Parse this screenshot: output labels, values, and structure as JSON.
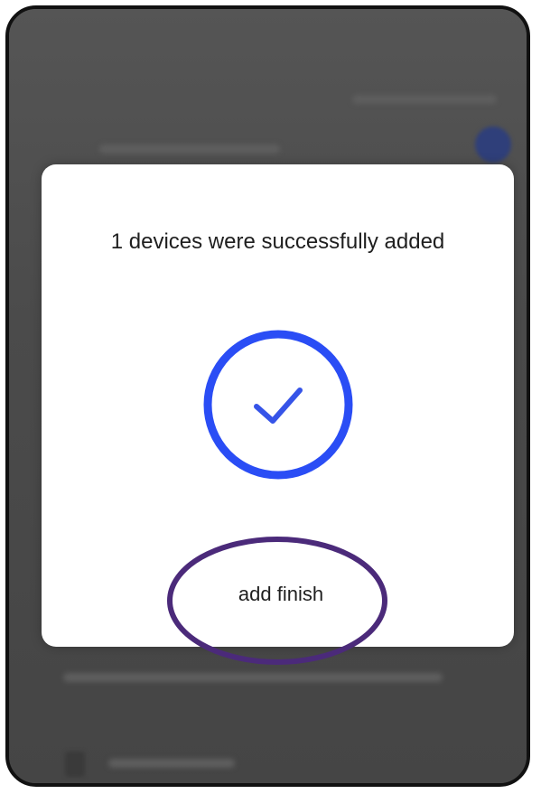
{
  "dialog": {
    "message": "1 devices were successfully added",
    "finish_label": "add finish"
  },
  "icons": {
    "success": "check-circle-icon"
  },
  "colors": {
    "accent": "#2a4df5",
    "annotation": "#4b2a7a",
    "overlay": "#4a4a4a"
  }
}
